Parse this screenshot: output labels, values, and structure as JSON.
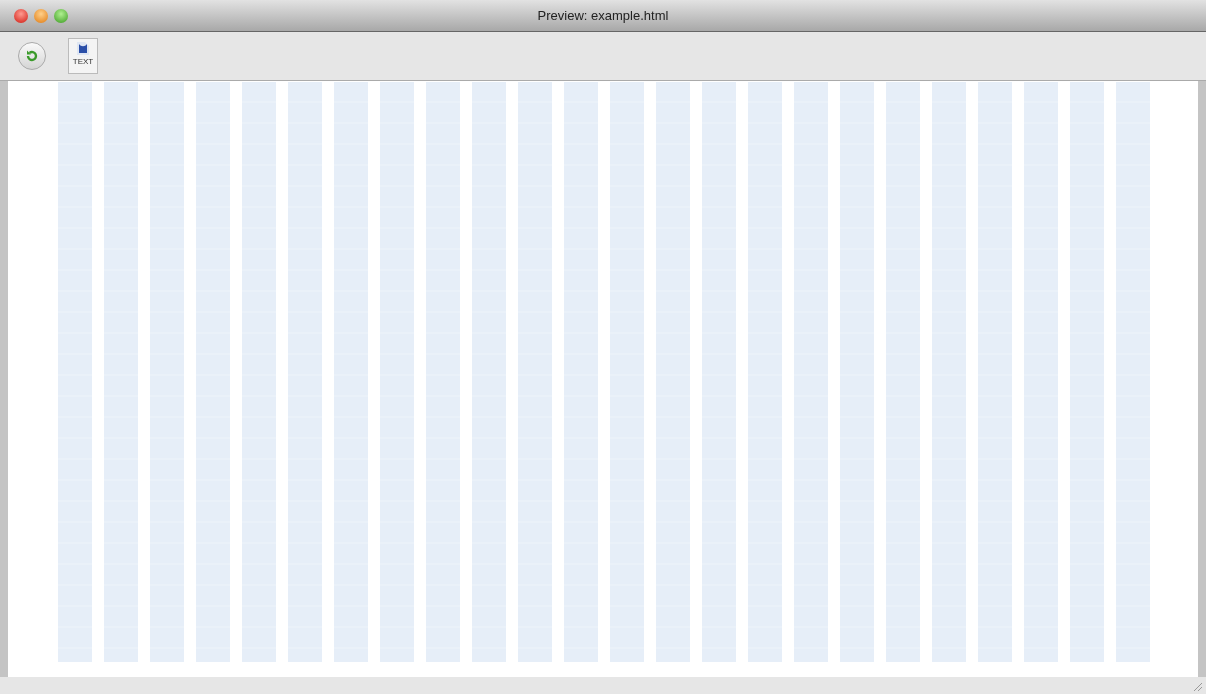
{
  "window": {
    "title": "Preview: example.html"
  },
  "toolbar": {
    "document_icon_label": "TEXT"
  }
}
